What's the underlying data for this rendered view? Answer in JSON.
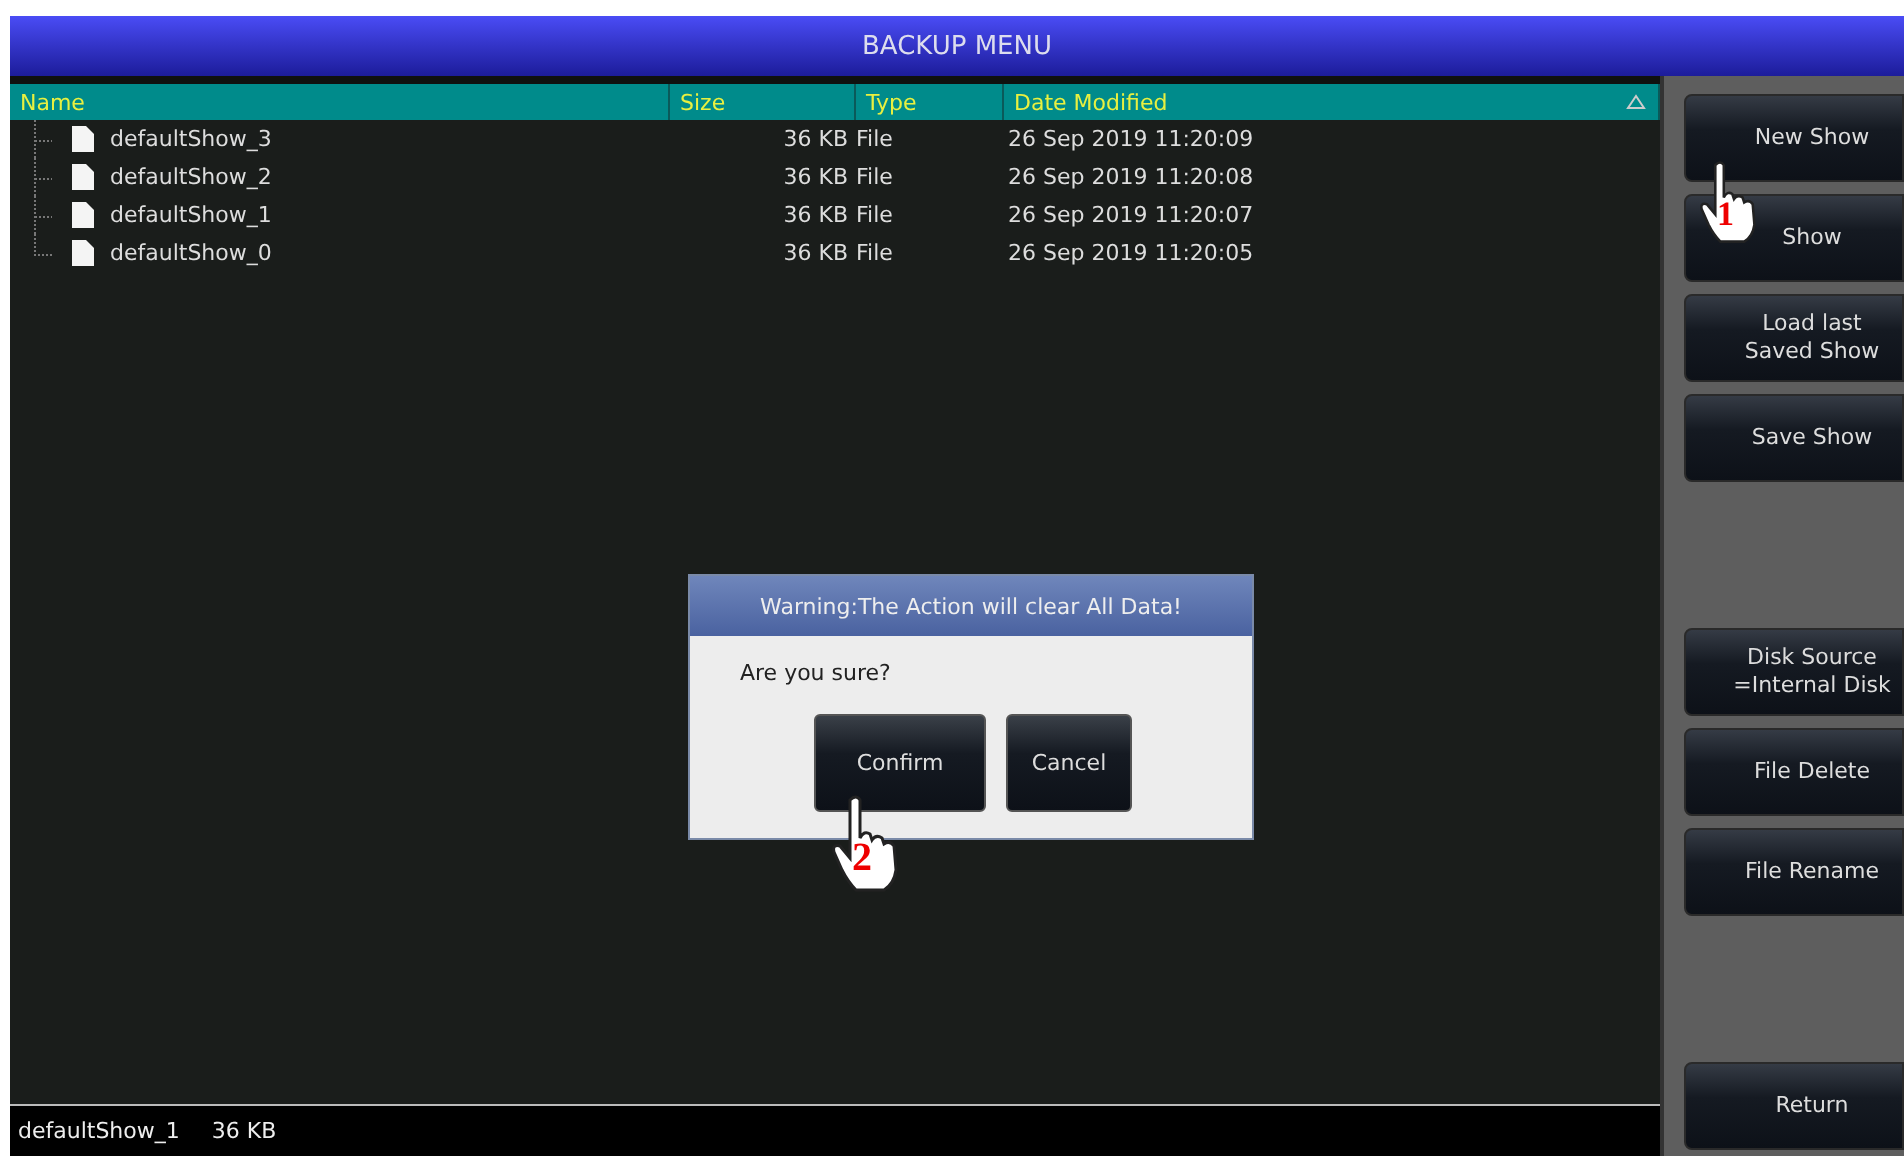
{
  "window": {
    "title": "BACKUP MENU"
  },
  "table": {
    "columns": [
      {
        "label": "Name"
      },
      {
        "label": "Size"
      },
      {
        "label": "Type"
      },
      {
        "label": "Date Modified",
        "sorted": true
      }
    ],
    "rows": [
      {
        "name": "defaultShow_3",
        "size": "36 KB",
        "type": "File",
        "date": "26 Sep 2019 11:20:09"
      },
      {
        "name": "defaultShow_2",
        "size": "36 KB",
        "type": "File",
        "date": "26 Sep 2019 11:20:08"
      },
      {
        "name": "defaultShow_1",
        "size": "36 KB",
        "type": "File",
        "date": "26 Sep 2019 11:20:07"
      },
      {
        "name": "defaultShow_0",
        "size": "36 KB",
        "type": "File",
        "date": "26 Sep 2019 11:20:05"
      }
    ]
  },
  "side_buttons": [
    [
      {
        "label": "New Show"
      },
      {
        "label": "Show"
      },
      {
        "label": "Load last\nSaved Show"
      },
      {
        "label": "Save Show"
      }
    ],
    [
      {
        "label": "Disk Source\n=Internal Disk"
      },
      {
        "label": "File Delete"
      },
      {
        "label": "File Rename"
      }
    ],
    [
      {
        "label": "Return"
      }
    ]
  ],
  "status_bar": {
    "file": "defaultShow_1",
    "size": "36 KB"
  },
  "dialog": {
    "title": "Warning:The Action will clear All Data!",
    "message": "Are you sure?",
    "buttons": [
      "Confirm",
      "Cancel"
    ]
  },
  "step_markers": [
    {
      "number": "1"
    },
    {
      "number": "2"
    }
  ]
}
